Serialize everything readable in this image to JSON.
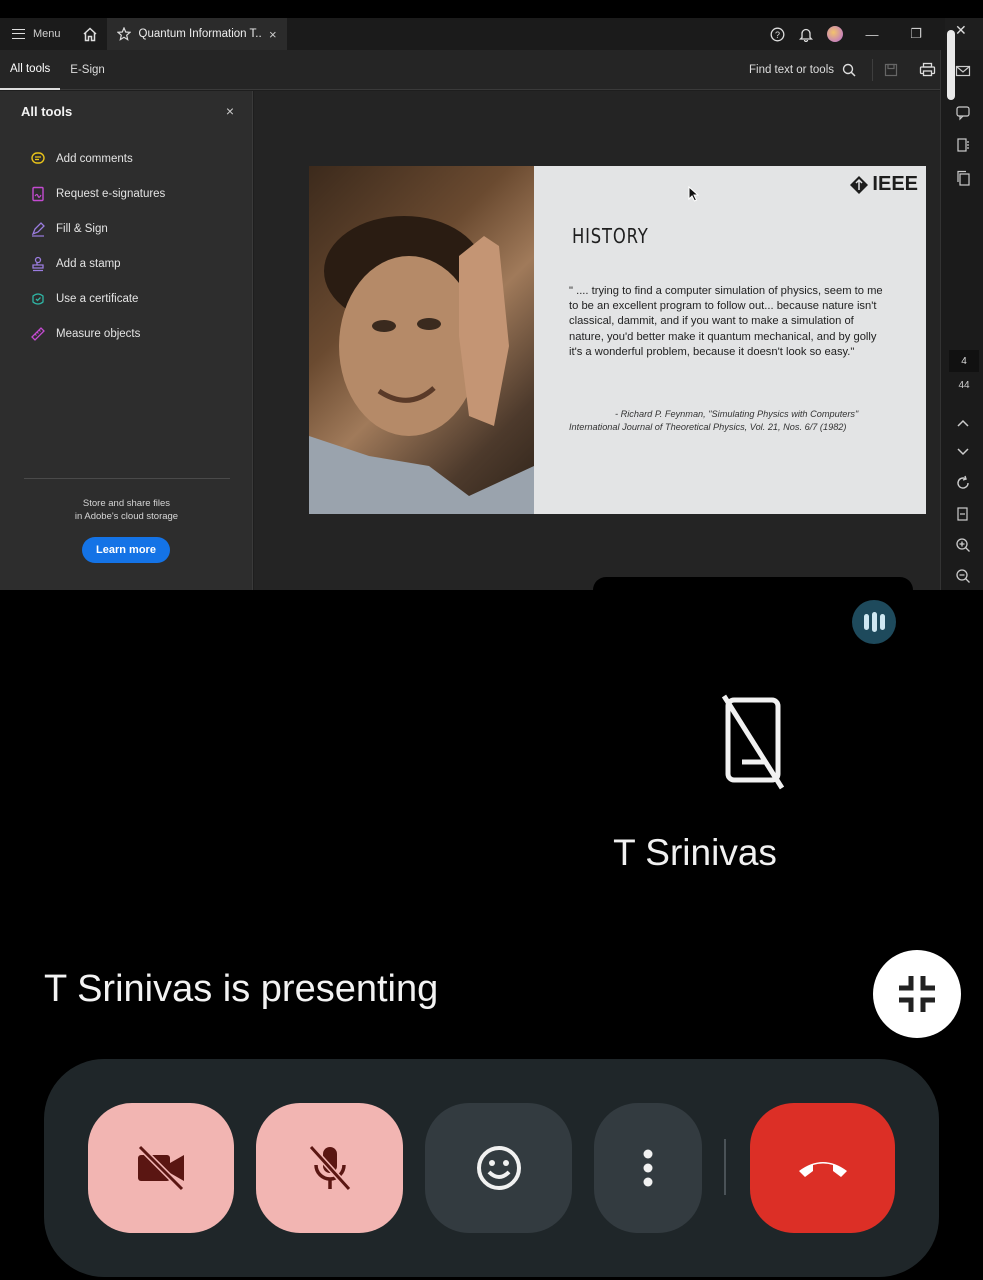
{
  "viewer": {
    "menu_label": "Menu",
    "tab_title": "Quantum Information T...",
    "toolbar_tabs": [
      "All tools",
      "E-Sign"
    ],
    "find_label": "Find text or tools",
    "panel": {
      "title": "All tools",
      "tools": [
        {
          "label": "Add comments",
          "icon": "comment-icon",
          "color": "#e8c31a"
        },
        {
          "label": "Request e-signatures",
          "icon": "esign-icon",
          "color": "#c44bd1"
        },
        {
          "label": "Fill & Sign",
          "icon": "fill-sign-icon",
          "color": "#9b7de0"
        },
        {
          "label": "Add a stamp",
          "icon": "stamp-icon",
          "color": "#9b7de0"
        },
        {
          "label": "Use a certificate",
          "icon": "certificate-icon",
          "color": "#2fb5a5"
        },
        {
          "label": "Measure objects",
          "icon": "ruler-icon",
          "color": "#c44bd1"
        }
      ],
      "cloud_line1": "Store and share files",
      "cloud_line2": "in Adobe's cloud storage",
      "learn_more": "Learn more"
    },
    "slide": {
      "logo": "IEEE",
      "title": "HISTORY",
      "quote": "\" .... trying to find a computer simulation of physics, seem to me to be an excellent program to follow out... because nature isn't classical, dammit, and if you want to make a simulation of nature, you'd better make it quantum mechanical, and by golly it's a wonderful problem, because it doesn't look so easy.\"",
      "cite1": "- Richard P. Feynman, \"Simulating Physics with Computers\"",
      "cite2": "International Journal of Theoretical Physics, Vol. 21, Nos. 6/7 (1982)"
    },
    "page_current": "4",
    "page_total": "44"
  },
  "meet": {
    "participant_name": "T Srinivas",
    "presenting_text": "T Srinivas is presenting",
    "colors": {
      "muted_button": "#f2b5b2",
      "leave_button": "#dc2f26",
      "neutral_button": "#333b40",
      "bar": "#1f2629"
    }
  }
}
